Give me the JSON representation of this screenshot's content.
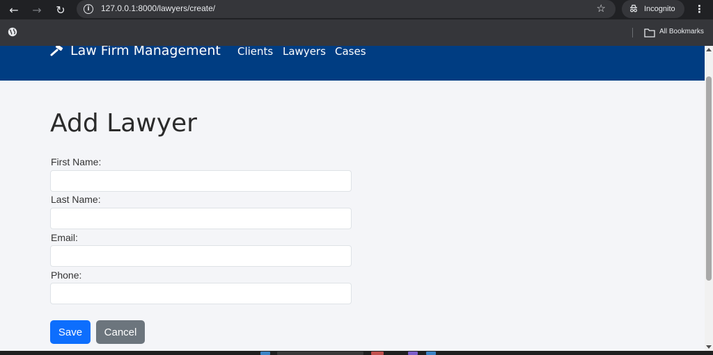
{
  "browser": {
    "url": "127.0.0.1:8000/lawyers/create/",
    "incognito_label": "Incognito",
    "bookmarks_label": "All Bookmarks"
  },
  "header": {
    "brand": "Law Firm Management",
    "nav": [
      "Clients",
      "Lawyers",
      "Cases"
    ]
  },
  "form": {
    "title": "Add Lawyer",
    "fields": [
      {
        "label": "First Name:",
        "value": ""
      },
      {
        "label": "Last Name:",
        "value": ""
      },
      {
        "label": "Email:",
        "value": ""
      },
      {
        "label": "Phone:",
        "value": ""
      }
    ],
    "save_label": "Save",
    "cancel_label": "Cancel"
  },
  "colors": {
    "header_bg": "#003d82",
    "save_button": "#0d6efd",
    "cancel_button": "#6c757d",
    "page_bg": "#f4f5f8"
  }
}
